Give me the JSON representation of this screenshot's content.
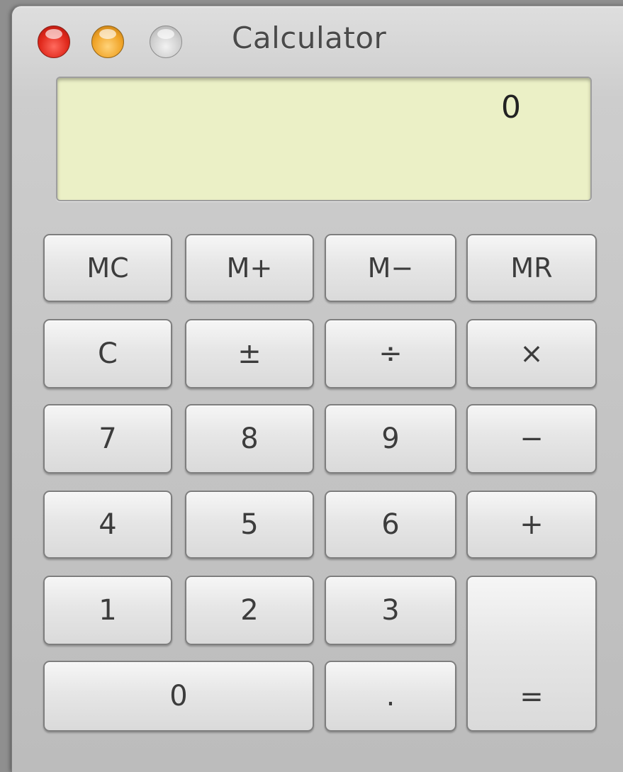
{
  "window": {
    "title": "Calculator"
  },
  "display": {
    "value": "0"
  },
  "keys": {
    "mc": "MC",
    "m_plus": "M+",
    "m_minus": "M−",
    "mr": "MR",
    "clear": "C",
    "plus_minus": "±",
    "divide": "÷",
    "multiply": "×",
    "seven": "7",
    "eight": "8",
    "nine": "9",
    "subtract": "−",
    "four": "4",
    "five": "5",
    "six": "6",
    "add": "+",
    "one": "1",
    "two": "2",
    "three": "3",
    "equals": "=",
    "zero": "0",
    "decimal": "."
  },
  "colors": {
    "display_background": "#ebf0c6",
    "close_button": "#e0281b",
    "minimize_button": "#f0a428",
    "zoom_button": "#cfcfcf"
  },
  "icons": {
    "close": "close-icon",
    "minimize": "minimize-icon",
    "zoom": "zoom-icon"
  }
}
